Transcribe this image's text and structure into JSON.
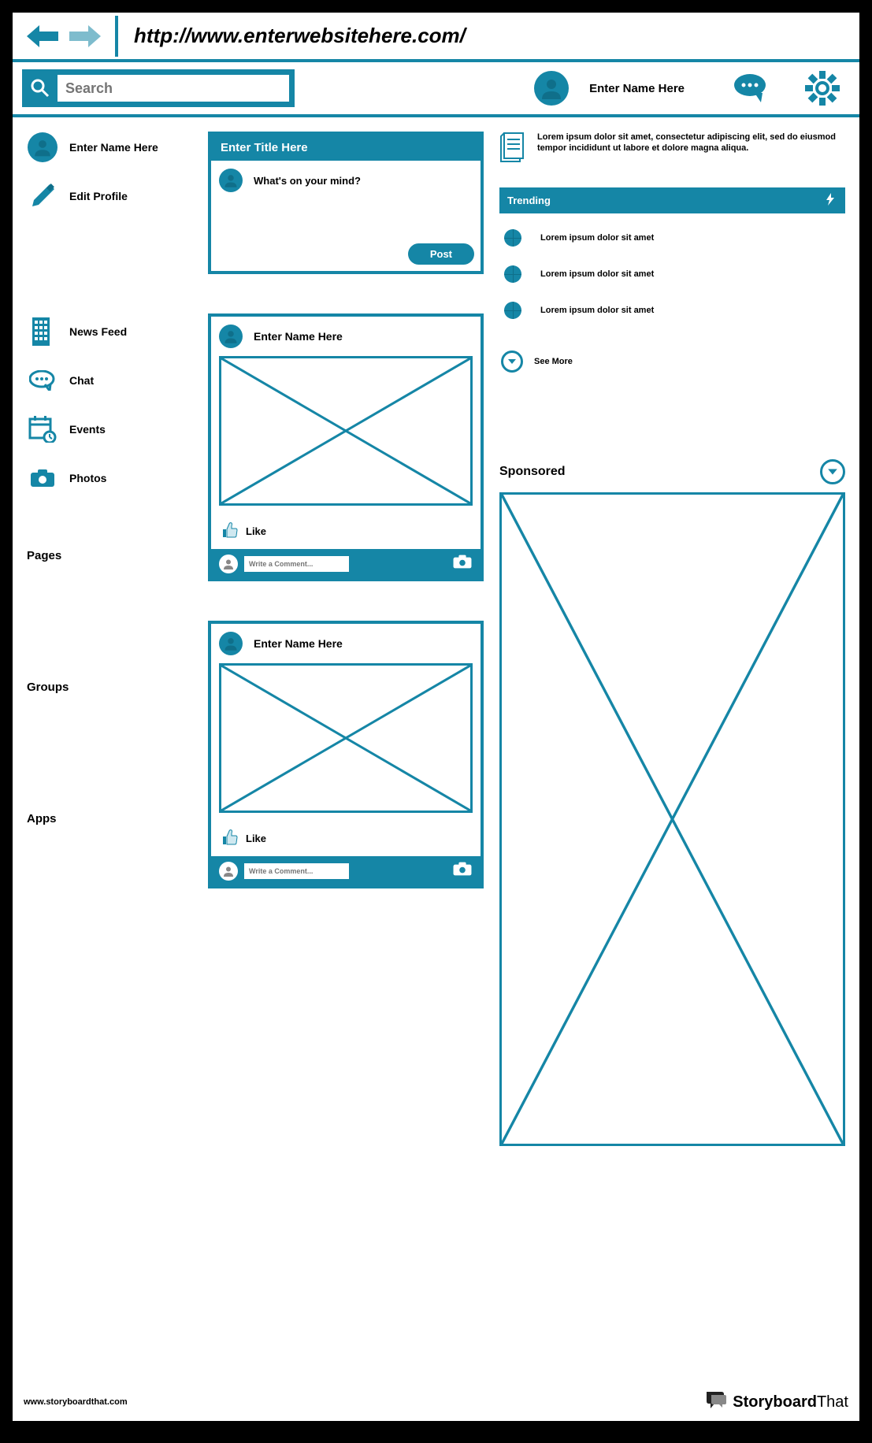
{
  "url": "http://www.enterwebsitehere.com/",
  "search": {
    "placeholder": "Search"
  },
  "top_user": "Enter Name Here",
  "sidebar": {
    "profile": {
      "name": "Enter Name Here",
      "edit": "Edit Profile"
    },
    "nav": [
      {
        "label": "News Feed"
      },
      {
        "label": "Chat"
      },
      {
        "label": "Events"
      },
      {
        "label": "Photos"
      }
    ],
    "headings": [
      "Pages",
      "Groups",
      "Apps"
    ]
  },
  "composer": {
    "title": "Enter Title Here",
    "prompt": "What's on your mind?",
    "post_btn": "Post"
  },
  "posts": [
    {
      "author": "Enter Name Here",
      "like": "Like",
      "comment_ph": "Write a Comment..."
    },
    {
      "author": "Enter Name Here",
      "like": "Like",
      "comment_ph": "Write a Comment..."
    }
  ],
  "right": {
    "doc_text": "Lorem ipsum dolor sit amet, consectetur adipiscing elit, sed do eiusmod tempor incididunt ut labore et dolore magna aliqua.",
    "trending_title": "Trending",
    "trending": [
      "Lorem ipsum dolor sit amet",
      "Lorem ipsum dolor sit amet",
      "Lorem ipsum dolor sit amet"
    ],
    "see_more": "See More",
    "sponsored": "Sponsored"
  },
  "footer": {
    "url": "www.storyboardthat.com",
    "brand1": "Storyboard",
    "brand2": "That"
  }
}
